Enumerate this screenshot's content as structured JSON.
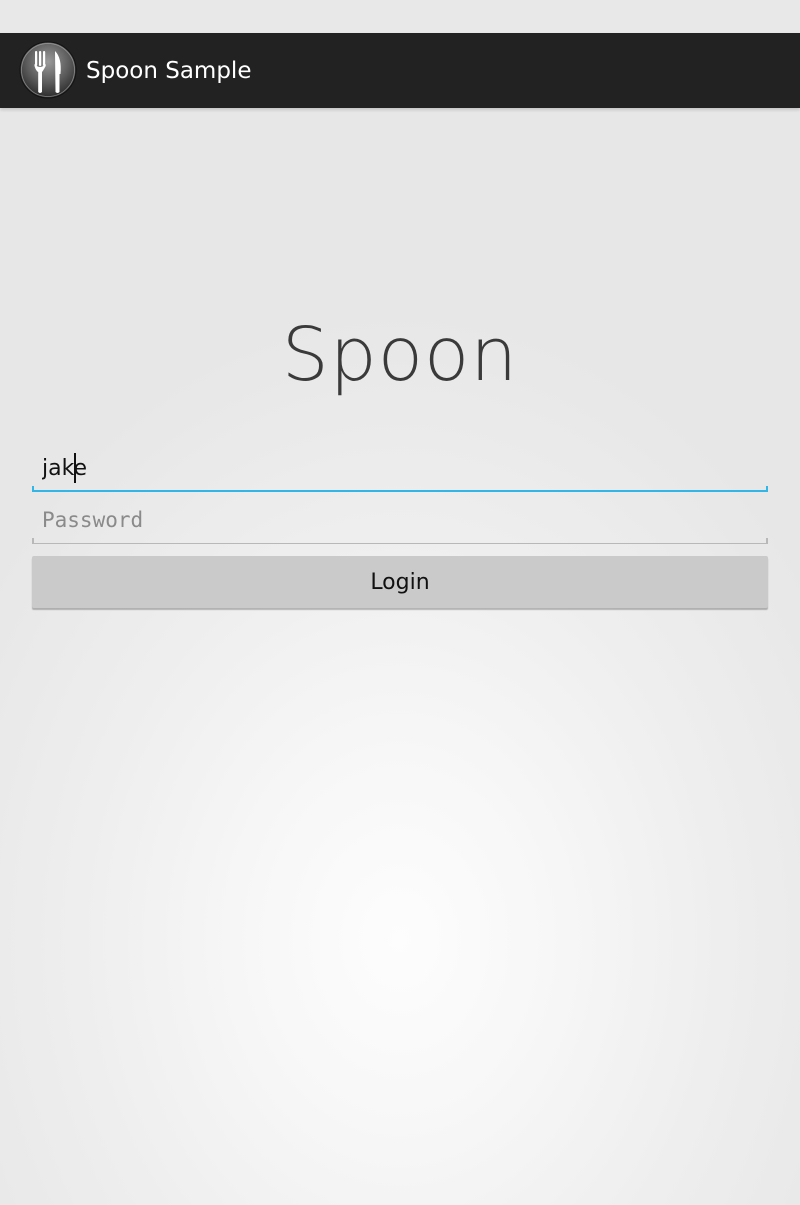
{
  "app": {
    "title": "Spoon Sample",
    "icon": "fork-knife-icon"
  },
  "main": {
    "logo_text": "Spoon"
  },
  "form": {
    "username": {
      "value": "jake",
      "placeholder": ""
    },
    "password": {
      "value": "",
      "placeholder": "Password"
    },
    "login_label": "Login"
  },
  "colors": {
    "action_bar": "#222222",
    "focus_accent": "#33b5e5",
    "button": "#cacaca"
  }
}
